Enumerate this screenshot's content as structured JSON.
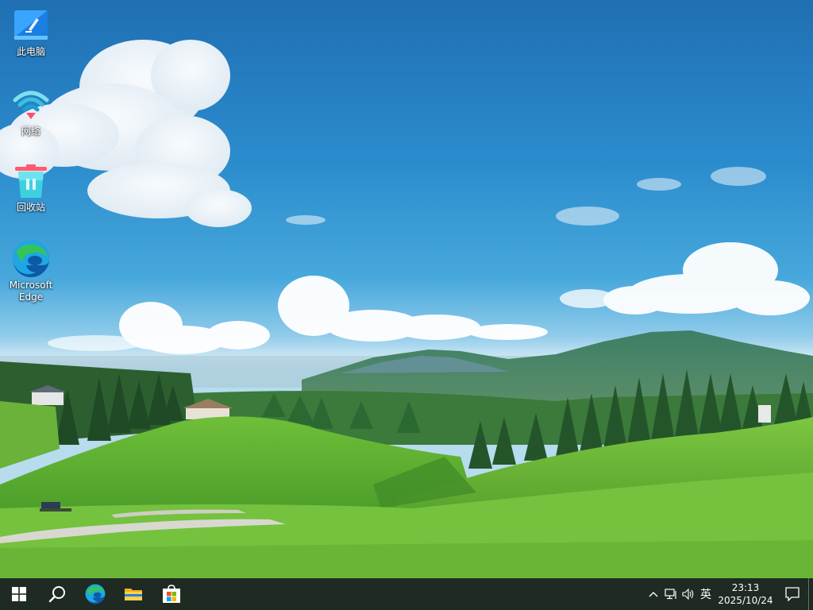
{
  "desktop": {
    "icons": [
      {
        "id": "this-pc",
        "label": "此电脑",
        "icon": "computer-icon"
      },
      {
        "id": "network",
        "label": "网络",
        "icon": "network-icon"
      },
      {
        "id": "recycle-bin",
        "label": "回收站",
        "icon": "recycle-bin-icon"
      },
      {
        "id": "edge",
        "label": "Microsoft Edge",
        "icon": "edge-icon"
      }
    ]
  },
  "taskbar": {
    "pinned": [
      {
        "id": "start",
        "icon": "windows-logo-icon"
      },
      {
        "id": "search",
        "icon": "search-icon"
      },
      {
        "id": "edge",
        "icon": "edge-icon"
      },
      {
        "id": "file-explorer",
        "icon": "folder-icon"
      },
      {
        "id": "store",
        "icon": "store-icon"
      }
    ],
    "tray": {
      "ime": "英",
      "time": "23:13",
      "date": "2025/10/24",
      "icons": [
        "chevron-up-icon",
        "network-icon",
        "volume-icon",
        "notification-icon"
      ]
    }
  },
  "colors": {
    "taskbar": "#1f2a23",
    "accent": "#0078d4"
  }
}
